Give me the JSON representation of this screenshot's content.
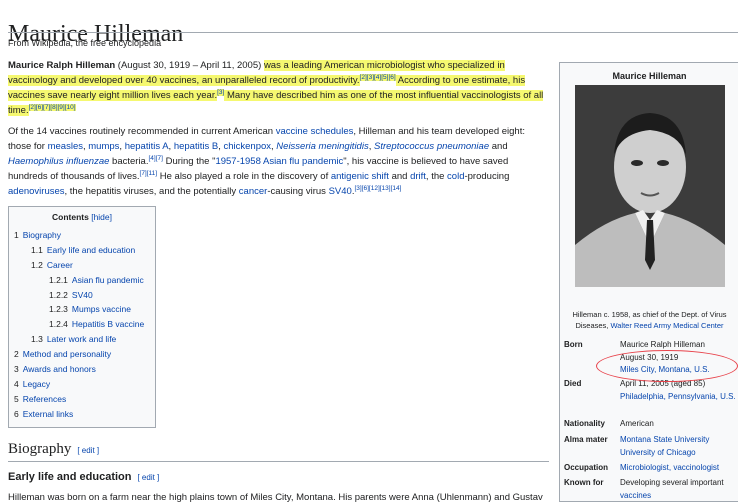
{
  "page": {
    "title": "Maurice Hilleman",
    "tagline": "From Wikipedia, the free encyclopedia"
  },
  "lead": {
    "name": "Maurice Ralph Hilleman",
    "dates": " (August 30, 1919 – April 11, 2005) ",
    "highlight1": "was a leading American microbiologist who specialized in vaccinology and developed over 40 vaccines, an unparalleled record of productivity.",
    "refs1": "[2][3][4][5][6]",
    "highlight2": " According to one estimate, his vaccines save nearly eight million lives each year.",
    "refs2": "[3]",
    "highlight3": " Many have described him as one of the most influential vaccinologists of all time.",
    "refs3": "[2][6][7][8][9][10]"
  },
  "para2": {
    "t1": "Of the 14 vaccines routinely recommended in current American ",
    "l_schedules": "vaccine schedules",
    "t2": ", Hilleman and his team developed eight: those for ",
    "l_measles": "measles",
    "l_mumps": "mumps",
    "l_hepA": "hepatitis A",
    "l_hepB": "hepatitis B",
    "l_chickenpox": "chickenpox",
    "l_neisseria": "Neisseria meningitidis",
    "l_strep": "Streptococcus pneumoniae",
    "t_and": " and ",
    "l_haemo": "Haemophilus influenzae",
    "t3": " bacteria.",
    "r1": "[4][7]",
    "t4": " During the \"",
    "l_flu": "1957-1958 Asian flu pandemic",
    "t5": "\", his vaccine is believed to have saved hundreds of thousands of lives.",
    "r2": "[7][11]",
    "t6": " He also played a role in the discovery of ",
    "l_shift": "antigenic shift",
    "l_drift": "drift",
    "t7": ", the ",
    "l_cold": "cold",
    "t8": "-producing ",
    "l_adeno": "adenoviruses",
    "t9": ", the hepatitis viruses, and the potentially ",
    "l_cancer": "cancer",
    "t10": "-causing virus ",
    "l_sv40": "SV40",
    "r3": "[3][6][12][13][14]"
  },
  "toc": {
    "title": "Contents",
    "hide": "[hide]",
    "items": [
      {
        "num": "1",
        "label": "Biography"
      },
      {
        "num": "1.1",
        "label": "Early life and education"
      },
      {
        "num": "1.2",
        "label": "Career"
      },
      {
        "num": "1.2.1",
        "label": "Asian flu pandemic"
      },
      {
        "num": "1.2.2",
        "label": "SV40"
      },
      {
        "num": "1.2.3",
        "label": "Mumps vaccine"
      },
      {
        "num": "1.2.4",
        "label": "Hepatitis B vaccine"
      },
      {
        "num": "1.3",
        "label": "Later work and life"
      },
      {
        "num": "2",
        "label": "Method and personality"
      },
      {
        "num": "3",
        "label": "Awards and honors"
      },
      {
        "num": "4",
        "label": "Legacy"
      },
      {
        "num": "5",
        "label": "References"
      },
      {
        "num": "6",
        "label": "External links"
      }
    ]
  },
  "sections": {
    "biography": "Biography",
    "edit": "[ edit ]",
    "early_life": "Early life and education",
    "cutoff_text": "Hilleman was born on a farm near the high plains town of Miles City, Montana. His parents were Anna (Uhlenmann) and Gustav"
  },
  "infobox": {
    "title": "Maurice Hilleman",
    "caption_text": "Hilleman c. 1958, as chief of the Dept. of Virus Diseases, ",
    "caption_link": "Walter Reed Army Medical Center",
    "born_label": "Born",
    "born_name": "Maurice Ralph Hilleman",
    "born_date": "August 30, 1919",
    "born_place": "Miles City, Montana, U.S.",
    "died_label": "Died",
    "died_date": "April 11, 2005 (aged 85)",
    "died_place": "Philadelphia, Pennsylvania, U.S.",
    "nationality_label": "Nationality",
    "nationality": "American",
    "alma_label": "Alma mater",
    "alma1": "Montana State University",
    "alma2": "University of Chicago",
    "occupation_label": "Occupation",
    "occupation": "Microbiologist, vaccinologist",
    "known_label": "Known for",
    "known_text": "Developing several important ",
    "known_link": "vaccines"
  },
  "colors": {
    "link": "#0645ad",
    "highlight": "#f5f870",
    "annotation_circle": "#e8434b"
  }
}
